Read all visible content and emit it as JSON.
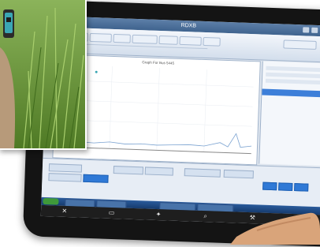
{
  "scene": {
    "subject": "tablet showing remote desktop analysis software with plot, plus inset photo of sensor in grass",
    "remote_window": {
      "title": "RDXB",
      "plot_title": "Graph For Bus 5445"
    },
    "toolbar_icons": [
      "close-icon",
      "briefcase-icon",
      "wand-icon",
      "search-icon",
      "wrench-icon",
      "gear-icon"
    ],
    "colors": {
      "tablet_body": "#141414",
      "title_blue": "#3f638e",
      "selection_blue": "#3d7fd9",
      "grass_green": "#5f8f2c",
      "sensor_cyan": "#3aa6b4"
    }
  }
}
